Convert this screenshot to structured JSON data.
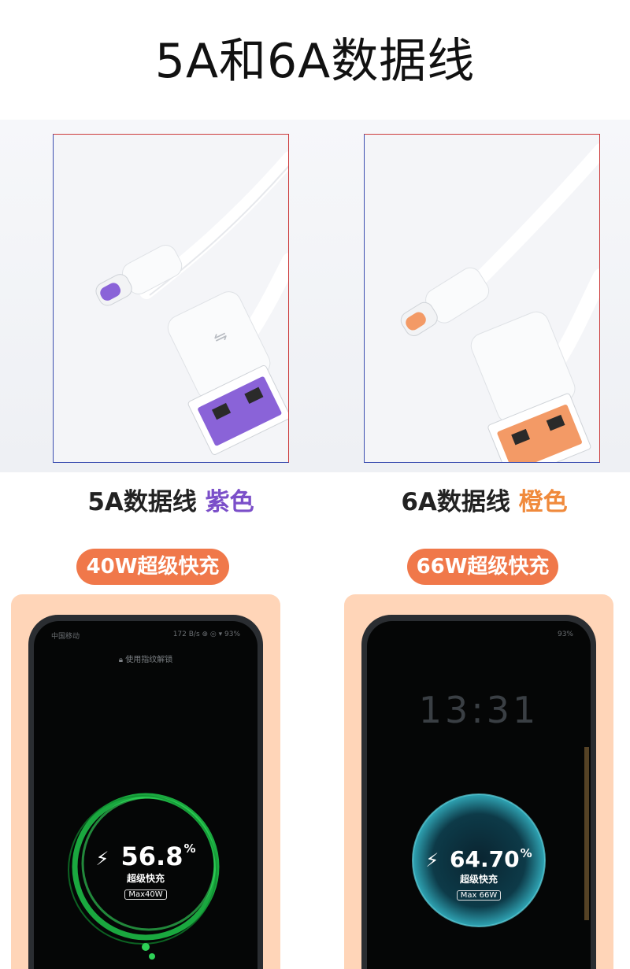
{
  "title": "5A和6A数据线",
  "products": [
    {
      "name": "5A数据线",
      "color_name": "紫色",
      "color": "#7b4fc9",
      "plug_color": "#8a63d8",
      "badge": "40W超级快充",
      "phone": {
        "status_left": "中国移动",
        "status_right": "172 B/s ⊕ ◎ ▾ 93%",
        "lock_hint": "使用指纹解锁",
        "battery_percent": "56.8",
        "percent_sign": "%",
        "charge_label": "超级快充",
        "max_label": "Max40W"
      }
    },
    {
      "name": "6A数据线",
      "color_name": "橙色",
      "color": "#f08a3c",
      "plug_color": "#f39a66",
      "badge": "66W超级快充",
      "phone": {
        "status_right": "93%",
        "clock": "13:31",
        "percent_sign": "%",
        "battery_percent": "64.70",
        "charge_label": "超级快充",
        "max_label": "Max 66W"
      }
    }
  ],
  "badge_color": "#f0784a",
  "card_color": "#ffd5b8"
}
